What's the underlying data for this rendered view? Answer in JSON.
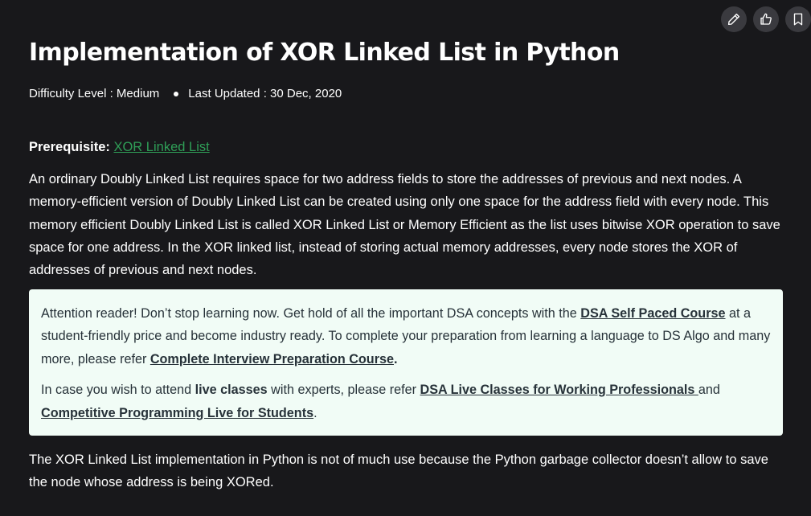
{
  "actions": {
    "edit": "edit",
    "like": "like",
    "bookmark": "bookmark"
  },
  "article": {
    "title": "Implementation of XOR Linked List in Python",
    "difficulty": "Difficulty Level : Medium",
    "last_updated": "Last Updated : 30 Dec, 2020",
    "prereq_label": "Prerequisite:",
    "prereq_link": "XOR Linked List",
    "paragraph1": "An ordinary Doubly Linked List requires space for two address fields to store the addresses of previous and next nodes. A memory-efficient version of Doubly Linked List can be created using only one space for the address field with every node. This memory efficient Doubly Linked List is called XOR Linked List or Memory Efficient as the list uses bitwise XOR operation to save space for one address. In the XOR linked list, instead of storing actual memory addresses, every node stores the XOR of addresses of previous and next nodes.",
    "paragraph2": "The XOR Linked List implementation in Python is not of much use because the Python garbage collector doesn’t allow to save the node whose address is being XORed."
  },
  "callout": {
    "p1_text1": "Attention reader! Don’t stop learning now. Get hold of all the important DSA concepts with the ",
    "p1_link1": "DSA Self Paced Course",
    "p1_text2": " at a student-friendly price and become industry ready.  To complete your preparation from learning a language to DS Algo and many more,  please refer ",
    "p1_link2": "Complete Interview Preparation Course",
    "p1_text3": ".",
    "p2_text1": "In case you wish to attend ",
    "p2_bold": "live classes",
    "p2_text2": " with experts, please refer ",
    "p2_link1": "DSA Live Classes for Working Professionals ",
    "p2_text3": "and ",
    "p2_link2": "Competitive Programming Live for Students",
    "p2_text4": "."
  },
  "colors": {
    "background": "#18181b",
    "link_green": "#2f9e57",
    "callout_bg": "#f1fcf6",
    "callout_text": "#273239"
  }
}
